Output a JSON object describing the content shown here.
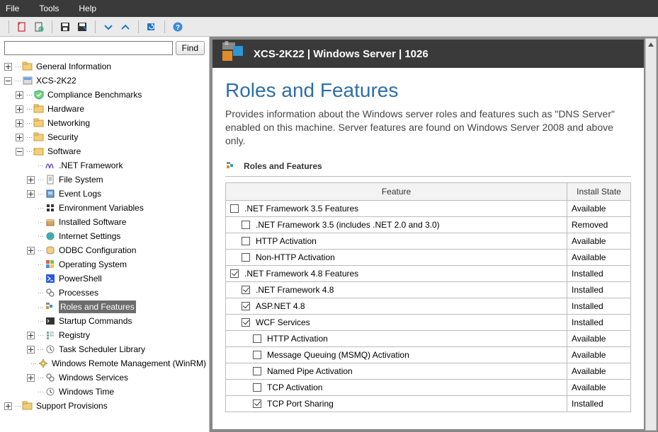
{
  "menubar": {
    "file": "File",
    "tools": "Tools",
    "help": "Help"
  },
  "search": {
    "placeholder": "",
    "findLabel": "Find"
  },
  "tree": {
    "generalInfo": "General Information",
    "host": "XCS-2K22",
    "compliance": "Compliance Benchmarks",
    "hardware": "Hardware",
    "networking": "Networking",
    "security": "Security",
    "software": "Software",
    "netFramework": ".NET Framework",
    "fileSystem": "File System",
    "eventLogs": "Event Logs",
    "envVars": "Environment Variables",
    "installedSoftware": "Installed Software",
    "internetSettings": "Internet Settings",
    "odbc": "ODBC Configuration",
    "os": "Operating System",
    "powershell": "PowerShell",
    "processes": "Processes",
    "rolesFeatures": "Roles and Features",
    "startupCmds": "Startup Commands",
    "registry": "Registry",
    "taskScheduler": "Task Scheduler Library",
    "winRM": "Windows Remote Management (WinRM)",
    "winServices": "Windows Services",
    "winTime": "Windows Time",
    "supportProvisions": "Support Provisions"
  },
  "header": {
    "title": "XCS-2K22 | Windows Server | 1026"
  },
  "page": {
    "title": "Roles and Features",
    "desc": "Provides information about the Windows server roles and features such as \"DNS Server\" enabled on this machine. Server features are found on Windows Server 2008 and above only.",
    "sectionLabel": "Roles and Features"
  },
  "table": {
    "colFeature": "Feature",
    "colState": "Install State",
    "rows": [
      {
        "checked": false,
        "indent": 0,
        "name": ".NET Framework 3.5 Features",
        "state": "Available"
      },
      {
        "checked": false,
        "indent": 1,
        "name": ".NET Framework 3.5 (includes .NET 2.0 and 3.0)",
        "state": "Removed"
      },
      {
        "checked": false,
        "indent": 1,
        "name": "HTTP Activation",
        "state": "Available"
      },
      {
        "checked": false,
        "indent": 1,
        "name": "Non-HTTP Activation",
        "state": "Available"
      },
      {
        "checked": true,
        "indent": 0,
        "name": ".NET Framework 4.8 Features",
        "state": "Installed"
      },
      {
        "checked": true,
        "indent": 1,
        "name": ".NET Framework 4.8",
        "state": "Installed"
      },
      {
        "checked": true,
        "indent": 1,
        "name": "ASP.NET 4.8",
        "state": "Installed"
      },
      {
        "checked": true,
        "indent": 1,
        "name": "WCF Services",
        "state": "Installed"
      },
      {
        "checked": false,
        "indent": 2,
        "name": "HTTP Activation",
        "state": "Available"
      },
      {
        "checked": false,
        "indent": 2,
        "name": "Message Queuing (MSMQ) Activation",
        "state": "Available"
      },
      {
        "checked": false,
        "indent": 2,
        "name": "Named Pipe Activation",
        "state": "Available"
      },
      {
        "checked": false,
        "indent": 2,
        "name": "TCP Activation",
        "state": "Available"
      },
      {
        "checked": true,
        "indent": 2,
        "name": "TCP Port Sharing",
        "state": "Installed"
      }
    ]
  }
}
